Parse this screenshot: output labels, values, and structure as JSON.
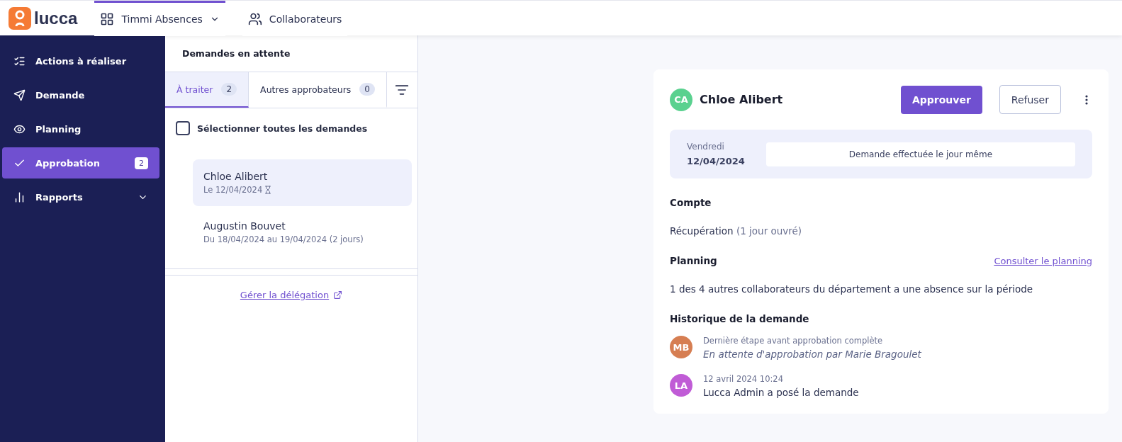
{
  "header": {
    "logo": "lucca",
    "nav": [
      {
        "label": "Timmi Absences",
        "kind": "apps",
        "selected": true,
        "dropdown": true
      },
      {
        "label": "Collaborateurs",
        "kind": "people",
        "selected": false,
        "dropdown": false
      }
    ]
  },
  "sidebar": {
    "items": [
      {
        "label": "Actions à réaliser",
        "selected": false
      },
      {
        "label": "Demande",
        "selected": false
      },
      {
        "label": "Planning",
        "selected": false
      },
      {
        "label": "Approbation",
        "selected": true,
        "badge": "2"
      },
      {
        "label": "Rapports",
        "selected": false,
        "expandable": true
      }
    ]
  },
  "requests_panel": {
    "title": "Demandes en attente",
    "tabs": [
      {
        "label": "À traiter",
        "count": "2",
        "selected": true
      },
      {
        "label": "Autres approbateurs",
        "count": "0",
        "selected": false
      }
    ],
    "select_all": {
      "label": "Sélectionner toutes les demandes",
      "checked": false
    },
    "requests": [
      {
        "name": "Chloe Alibert",
        "dates": "Le 12/04/2024",
        "pending": true,
        "selected": true
      },
      {
        "name": "Augustin Bouvet",
        "dates": "Du 18/04/2024 au 19/04/2024 (2 jours)",
        "pending": false,
        "selected": false
      }
    ],
    "delegation_link": "Gérer la délégation"
  },
  "detail": {
    "person": {
      "initials": "CA",
      "name": "Chloe Alibert",
      "color": "#5ad18f"
    },
    "actions": {
      "approve": "Approuver",
      "refuse": "Refuser"
    },
    "date": {
      "day": "Vendredi",
      "date": "12/04/2024",
      "note": "Demande effectuée le jour même"
    },
    "account": {
      "title": "Compte",
      "type": "Récupération",
      "detail": "(1 jour ouvré)"
    },
    "planning": {
      "title": "Planning",
      "link": "Consulter le planning",
      "text": "1 des 4 autres collaborateurs du département a une absence sur la période"
    },
    "history": {
      "title": "Historique de la demande",
      "items": [
        {
          "initials": "MB",
          "color": "#d67e52",
          "meta": "Dernière étape avant approbation complète",
          "text": "En attente d'approbation par Marie Bragoulet",
          "kind": "pending"
        },
        {
          "initials": "LA",
          "color": "#c05cd6",
          "meta": "12 avril 2024 10:24",
          "text": "Lucca Admin a posé la demande",
          "kind": "done"
        }
      ]
    }
  }
}
